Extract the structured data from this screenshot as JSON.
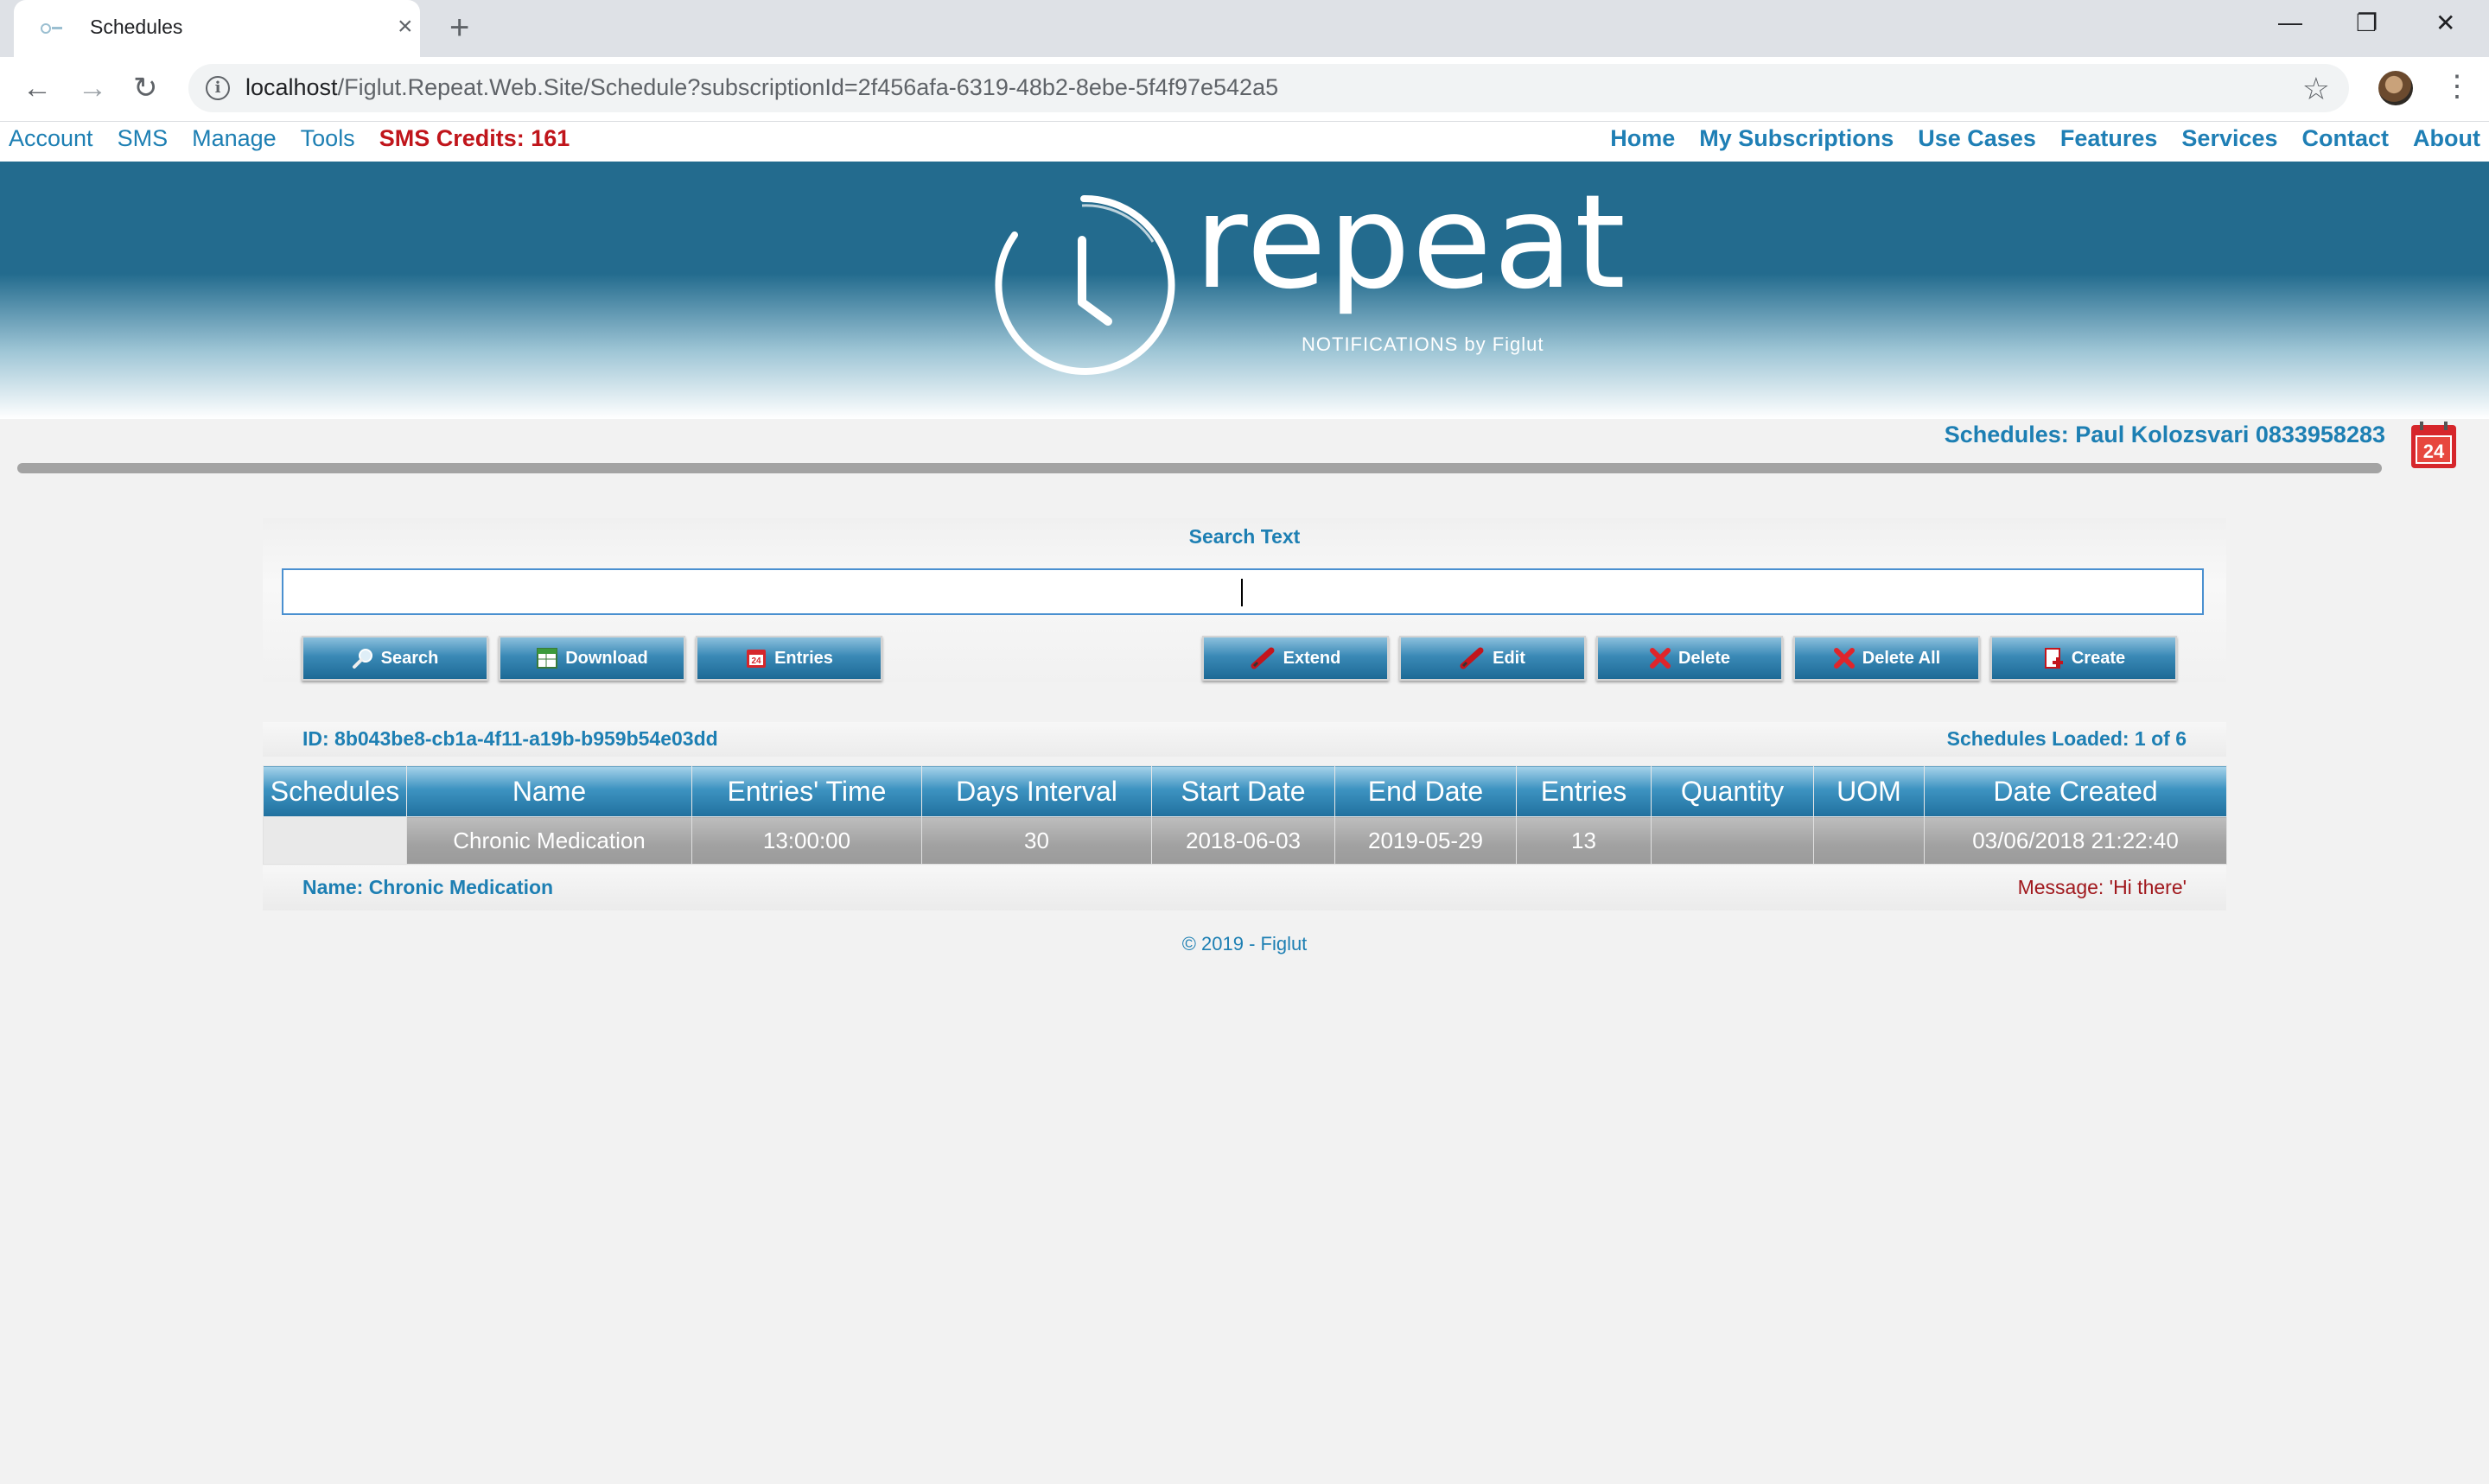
{
  "browser": {
    "tab_title": "Schedules",
    "tab_close": "×",
    "new_tab": "+",
    "url_host": "localhost",
    "url_path": "/Figlut.Repeat.Web.Site/Schedule?subscriptionId=2f456afa-6319-48b2-8ebe-5f4f97e542a5",
    "back": "←",
    "forward": "→",
    "reload": "↻",
    "star": "☆",
    "menu": "⋮",
    "minimize": "—",
    "restore": "❐",
    "close": "✕"
  },
  "topmenu": {
    "left": [
      "Account",
      "SMS",
      "Manage",
      "Tools"
    ],
    "credits": "SMS Credits: 161",
    "right": [
      "Home",
      "My Subscriptions",
      "Use Cases",
      "Features",
      "Services",
      "Contact",
      "About"
    ]
  },
  "banner": {
    "logo_word": "repeat",
    "logo_sub": "NOTIFICATIONS by Figlut"
  },
  "page": {
    "schedules_title": "Schedules: Paul Kolozsvari 0833958283",
    "search_label": "Search Text",
    "search_value": ""
  },
  "buttons": {
    "search": "Search",
    "download": "Download",
    "entries": "Entries",
    "extend": "Extend",
    "edit": "Edit",
    "delete": "Delete",
    "delete_all": "Delete All",
    "create": "Create"
  },
  "info": {
    "id": "ID: 8b043be8-cb1a-4f11-a19b-b959b54e03dd",
    "loaded": "Schedules Loaded: 1 of 6"
  },
  "table": {
    "columns": [
      "Schedules",
      "Name",
      "Entries' Time",
      "Days Interval",
      "Start Date",
      "End Date",
      "Entries",
      "Quantity",
      "UOM",
      "Date Created"
    ],
    "rows": [
      [
        "",
        "Chronic Medication",
        "13:00:00",
        "30",
        "2018-06-03",
        "2019-05-29",
        "13",
        "",
        "",
        "03/06/2018 21:22:40"
      ]
    ]
  },
  "detail": {
    "name": "Name: Chronic Medication",
    "message": "Message: 'Hi there'"
  },
  "footer": "© 2019 - Figlut",
  "colors": {
    "accent": "#1d7fb3",
    "banner": "#236b8e",
    "alert": "#c0151b"
  }
}
